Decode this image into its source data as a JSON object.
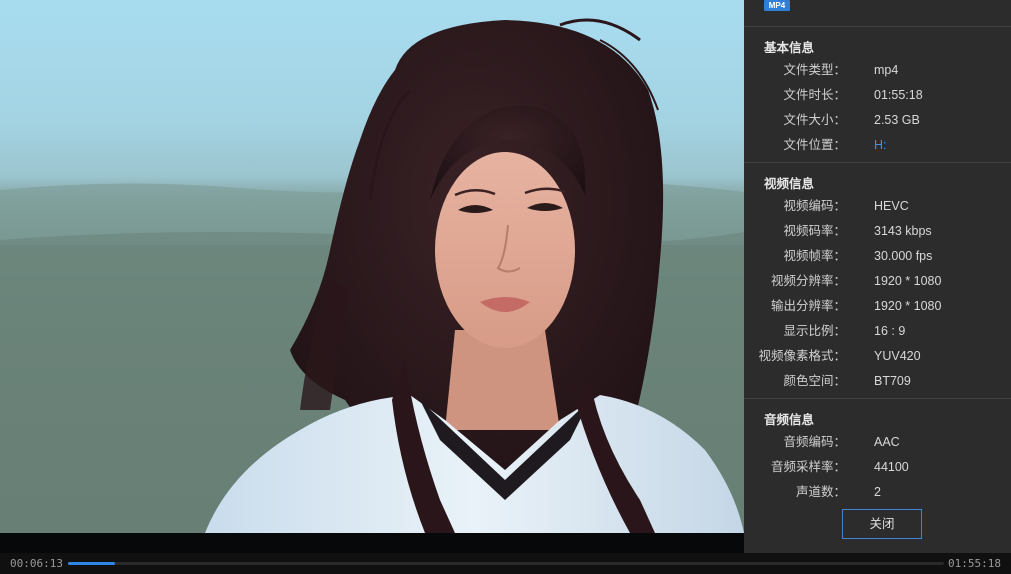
{
  "format_badge": "MP4",
  "sections": {
    "basic": {
      "title": "基本信息",
      "rows": [
        {
          "label": "文件类型：",
          "value": "mp4"
        },
        {
          "label": "文件时长：",
          "value": "01:55:18"
        },
        {
          "label": "文件大小：",
          "value": "2.53 GB"
        },
        {
          "label": "文件位置：",
          "value": "H:"
        }
      ]
    },
    "video": {
      "title": "视频信息",
      "rows": [
        {
          "label": "视频编码：",
          "value": "HEVC"
        },
        {
          "label": "视频码率：",
          "value": "3143 kbps"
        },
        {
          "label": "视频帧率：",
          "value": "30.000 fps"
        },
        {
          "label": "视频分辨率：",
          "value": "1920 * 1080"
        },
        {
          "label": "输出分辨率：",
          "value": "1920 * 1080"
        },
        {
          "label": "显示比例：",
          "value": "16 : 9"
        },
        {
          "label": "视频像素格式：",
          "value": "YUV420"
        },
        {
          "label": "颜色空间：",
          "value": "BT709"
        }
      ]
    },
    "audio": {
      "title": "音频信息",
      "rows": [
        {
          "label": "音频编码：",
          "value": "AAC"
        },
        {
          "label": "音频采样率：",
          "value": "44100"
        },
        {
          "label": "声道数：",
          "value": "2"
        }
      ]
    }
  },
  "close_label": "关闭",
  "player": {
    "current_time": "00:06:13",
    "total_time": "01:55:18",
    "progress_fraction": 0.054
  },
  "colors": {
    "accent": "#2f86e6",
    "panel_bg": "#2c2c2c",
    "link": "#3d8ee8"
  }
}
